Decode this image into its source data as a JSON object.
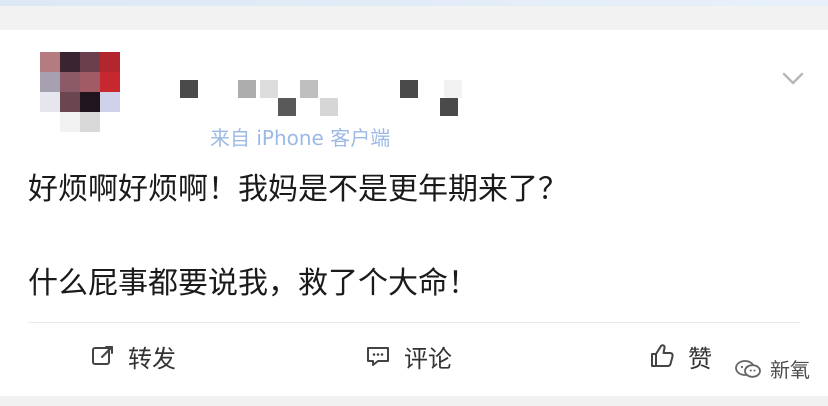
{
  "post": {
    "source_text": "来自 iPhone 客户端",
    "lines": [
      "好烦啊好烦啊！我妈是不是更年期来了？",
      "什么屁事都要说我，救了个大命！"
    ]
  },
  "actions": {
    "repost_label": "转发",
    "comment_label": "评论",
    "like_label": "赞"
  },
  "watermark": {
    "label": "新氧"
  },
  "icons": {
    "repost": "repost-icon",
    "comment": "comment-icon",
    "like": "thumbs-up-icon",
    "more": "chevron-down-icon",
    "watermark": "wechat-icon"
  },
  "colors": {
    "meta_blue": "#5b8bd5",
    "text": "#1a1a1a"
  }
}
